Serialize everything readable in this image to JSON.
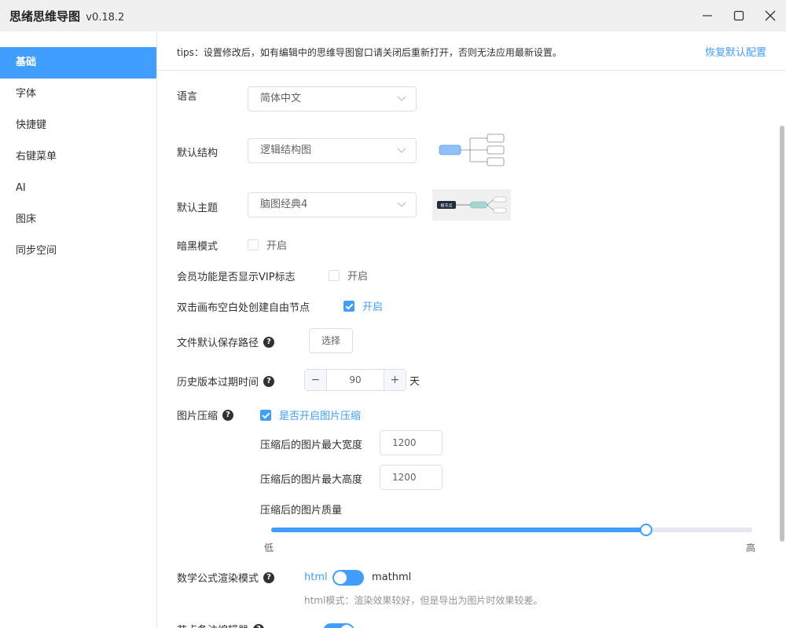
{
  "window": {
    "title": "思绪思维导图",
    "version": "v0.18.2"
  },
  "sidebar": {
    "items": [
      {
        "label": "基础",
        "active": true
      },
      {
        "label": "字体"
      },
      {
        "label": "快捷键"
      },
      {
        "label": "右键菜单"
      },
      {
        "label": "AI"
      },
      {
        "label": "图床"
      },
      {
        "label": "同步空间"
      }
    ]
  },
  "tips": {
    "text": "tips：设置修改后，如有编辑中的思维导图窗口请关闭后重新打开，否则无法应用最新设置。",
    "reset_label": "恢复默认配置"
  },
  "settings": {
    "language": {
      "label": "语言",
      "value": "简体中文"
    },
    "structure": {
      "label": "默认结构",
      "value": "逻辑结构图"
    },
    "theme": {
      "label": "默认主题",
      "value": "脑图经典4",
      "preview_node": "根节点"
    },
    "dark_mode": {
      "label": "暗黑模式",
      "option": "开启",
      "checked": false
    },
    "vip_badge": {
      "label": "会员功能是否显示VIP标志",
      "option": "开启",
      "checked": false
    },
    "free_node": {
      "label": "双击画布空白处创建自由节点",
      "option": "开启",
      "checked": true
    },
    "save_path": {
      "label": "文件默认保存路径",
      "button": "选择"
    },
    "history_expiry": {
      "label": "历史版本过期时间",
      "value": "90",
      "unit": "天",
      "minus": "−",
      "plus": "+"
    },
    "image_compress": {
      "label": "图片压缩",
      "option": "是否开启图片压缩",
      "checked": true,
      "max_width_label": "压缩后的图片最大宽度",
      "max_width": "1200",
      "max_height_label": "压缩后的图片最大高度",
      "max_height": "1200",
      "quality_label": "压缩后的图片质量",
      "quality_low": "低",
      "quality_high": "高",
      "quality_fraction": 0.78
    },
    "math_render": {
      "label": "数学公式渲染模式",
      "left_option": "html",
      "right_option": "mathml",
      "selected": "html",
      "hint": "html模式：渲染效果较好，但是导出为图片时效果较差。"
    },
    "next_row": {
      "label": "节点备注编辑器"
    }
  },
  "colors": {
    "accent": "#409eff",
    "text": "#303133",
    "border": "#dcdfe6"
  }
}
